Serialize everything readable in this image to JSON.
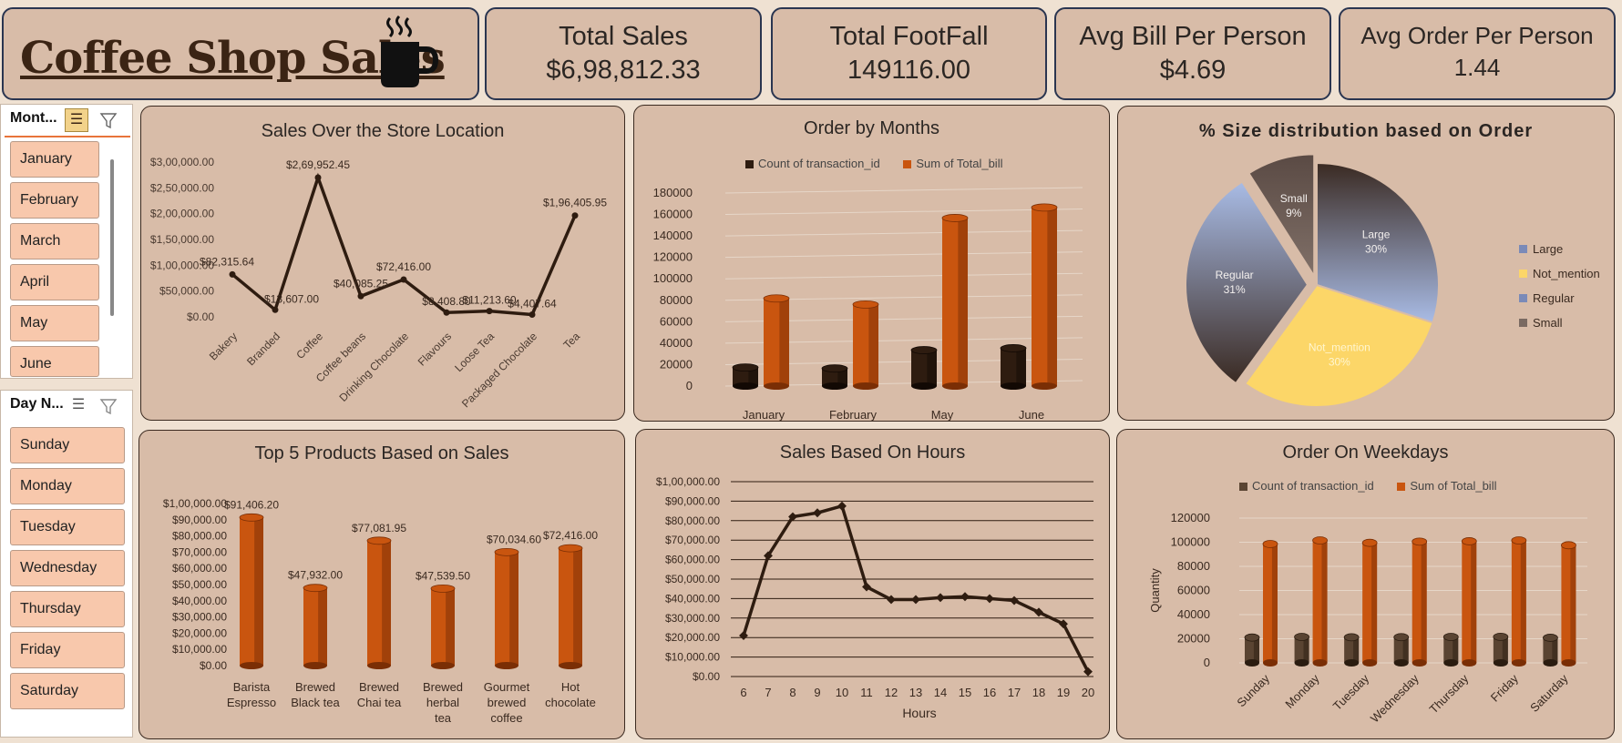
{
  "dashboard": {
    "title": "Coffee Shop Sales",
    "mug_icon": "coffee-mug-icon"
  },
  "kpis": [
    {
      "label": "Total Sales",
      "value": "$6,98,812.33"
    },
    {
      "label": "Total FootFall",
      "value": "149116.00"
    },
    {
      "label": "Avg Bill Per Person",
      "value": "$4.69"
    },
    {
      "label": "Avg Order Per Person",
      "value": "1.44"
    }
  ],
  "slicers": {
    "month": {
      "header": "Mont...",
      "items": [
        "January",
        "February",
        "March",
        "April",
        "May",
        "June"
      ]
    },
    "day": {
      "header": "Day N...",
      "items": [
        "Sunday",
        "Monday",
        "Tuesday",
        "Wednesday",
        "Thursday",
        "Friday",
        "Saturday"
      ]
    }
  },
  "colors": {
    "dark": "#2e1c10",
    "orange": "#c9550f",
    "panel": "#d8bca8",
    "yellow": "#fcd668"
  },
  "chart_data": [
    {
      "id": "store_location",
      "type": "line",
      "title": "Sales Over the Store Location",
      "categories": [
        "Bakery",
        "Branded",
        "Coffee",
        "Coffee beans",
        "Drinking Chocolate",
        "Flavours",
        "Loose Tea",
        "Packaged Chocolate",
        "Tea"
      ],
      "values": [
        82315.64,
        13607.0,
        269952.45,
        40085.25,
        72416.0,
        8408.8,
        11213.6,
        4407.64,
        196405.95
      ],
      "labels": [
        "$82,315.64",
        "$13,607.00",
        "$2,69,952.45",
        "$40,085.25",
        "$72,416.00",
        "$8,408.80",
        "$11,213.60",
        "$4,407.64",
        "$1,96,405.95"
      ],
      "yticks": [
        "$0.00",
        "$50,000.00",
        "$1,00,000.00",
        "$1,50,000.00",
        "$2,00,000.00",
        "$2,50,000.00",
        "$3,00,000.00"
      ],
      "ylim": [
        0,
        300000
      ]
    },
    {
      "id": "order_months",
      "type": "bar",
      "title": "Order by Months",
      "categories": [
        "January",
        "February",
        "May",
        "June"
      ],
      "series": [
        {
          "name": "Count of transaction_id",
          "values": [
            17300,
            16400,
            33500,
            35300
          ]
        },
        {
          "name": "Sum of Total_bill",
          "values": [
            81700,
            76100,
            156700,
            166500
          ]
        }
      ],
      "yticks": [
        "0",
        "20000",
        "40000",
        "60000",
        "80000",
        "100000",
        "120000",
        "140000",
        "160000",
        "180000"
      ],
      "ylim": [
        0,
        180000
      ]
    },
    {
      "id": "size_distribution",
      "type": "pie",
      "title": "% Size distribution based on Order",
      "slices": [
        {
          "name": "Large",
          "value": 30,
          "label": "30%"
        },
        {
          "name": "Not_mention",
          "value": 30,
          "label": "30%"
        },
        {
          "name": "Regular",
          "value": 31,
          "label": "31%"
        },
        {
          "name": "Small",
          "value": 9,
          "label": "9%"
        }
      ],
      "legend": [
        "Large",
        "Not_mention",
        "Regular",
        "Small"
      ],
      "legend_position": "right"
    },
    {
      "id": "top_products",
      "type": "bar",
      "title": "Top 5 Products Based on Sales",
      "categories": [
        "Barista Espresso",
        "Brewed Black tea",
        "Brewed Chai tea",
        "Brewed herbal tea",
        "Gourmet brewed coffee",
        "Hot chocolate"
      ],
      "category_lines": [
        [
          "Barista",
          "Espresso"
        ],
        [
          "Brewed",
          "Black tea"
        ],
        [
          "Brewed",
          "Chai tea"
        ],
        [
          "Brewed",
          "herbal",
          "tea"
        ],
        [
          "Gourmet",
          "brewed",
          "coffee"
        ],
        [
          "Hot",
          "chocolate"
        ]
      ],
      "values": [
        91406.2,
        47932.0,
        77081.95,
        47539.5,
        70034.6,
        72416.0
      ],
      "labels": [
        "$91,406.20",
        "$47,932.00",
        "$77,081.95",
        "$47,539.50",
        "$70,034.60",
        "$72,416.00"
      ],
      "yticks": [
        "$0.00",
        "$10,000.00",
        "$20,000.00",
        "$30,000.00",
        "$40,000.00",
        "$50,000.00",
        "$60,000.00",
        "$70,000.00",
        "$80,000.00",
        "$90,000.00",
        "$1,00,000.00"
      ],
      "ylim": [
        0,
        100000
      ]
    },
    {
      "id": "hours",
      "type": "line",
      "title": "Sales Based On Hours",
      "xlabel": "Hours",
      "x": [
        6,
        7,
        8,
        9,
        10,
        11,
        12,
        13,
        14,
        15,
        16,
        17,
        18,
        19,
        20
      ],
      "values": [
        21000,
        62000,
        82000,
        84000,
        87500,
        46000,
        39500,
        39500,
        40500,
        41000,
        40000,
        39000,
        33000,
        27000,
        2500
      ],
      "yticks": [
        "$0.00",
        "$10,000.00",
        "$20,000.00",
        "$30,000.00",
        "$40,000.00",
        "$50,000.00",
        "$60,000.00",
        "$70,000.00",
        "$80,000.00",
        "$90,000.00",
        "$1,00,000.00"
      ],
      "ylim": [
        0,
        100000
      ]
    },
    {
      "id": "weekdays",
      "type": "bar",
      "title": "Order On Weekdays",
      "ylabel": "Quantity",
      "categories": [
        "Sunday",
        "Monday",
        "Tuesday",
        "Wednesday",
        "Thursday",
        "Friday",
        "Saturday"
      ],
      "series": [
        {
          "name": "Count of transaction_id",
          "values": [
            21000,
            21500,
            21200,
            21300,
            21500,
            21600,
            20800
          ]
        },
        {
          "name": "Sum of Total_bill",
          "values": [
            98500,
            101500,
            99500,
            100500,
            100800,
            101500,
            97500
          ]
        }
      ],
      "yticks": [
        "0",
        "20000",
        "40000",
        "60000",
        "80000",
        "100000",
        "120000"
      ],
      "ylim": [
        0,
        120000
      ]
    }
  ]
}
